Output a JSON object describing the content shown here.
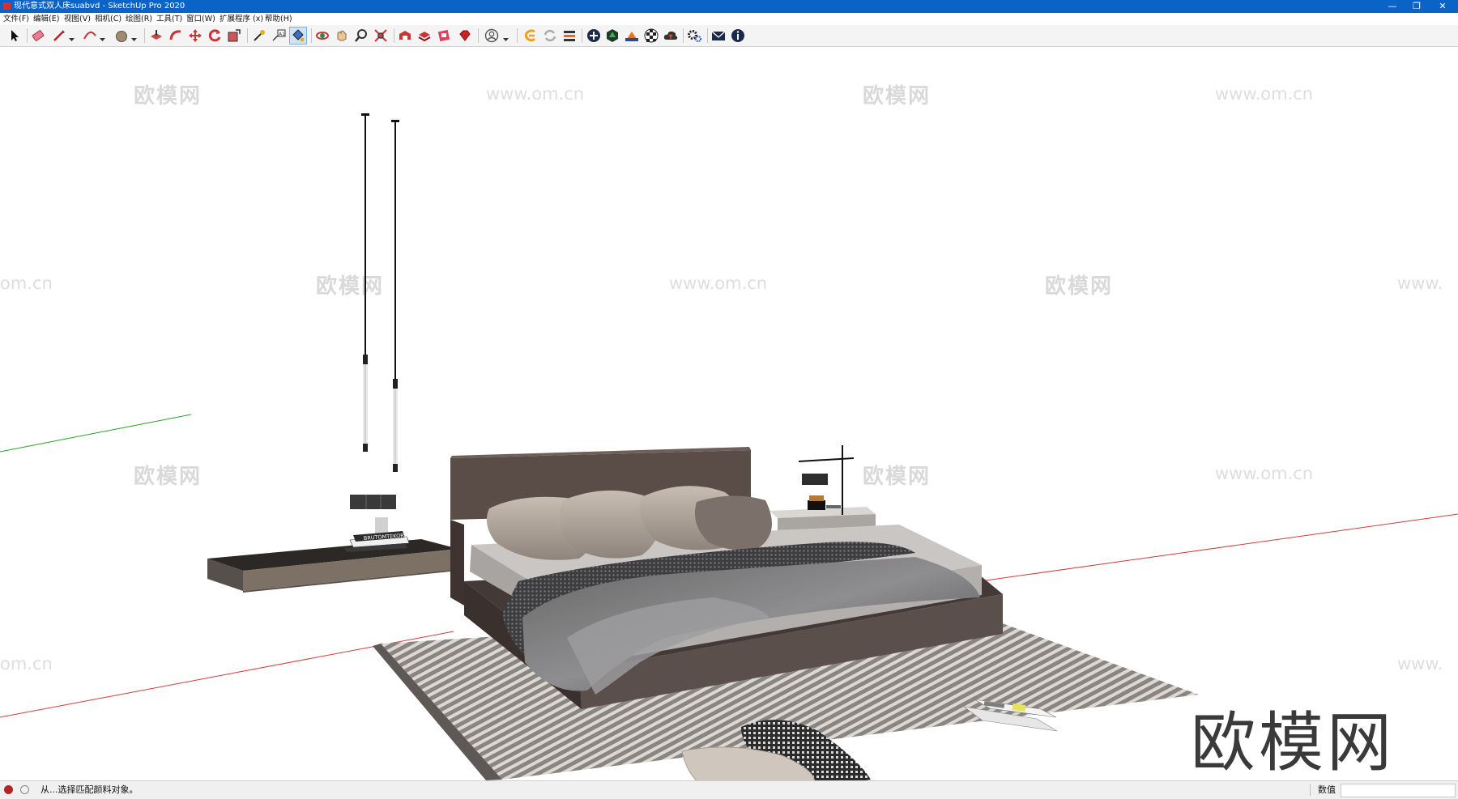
{
  "window": {
    "title": "现代意式双人床suabvd - SketchUp Pro 2020",
    "minimize_glyph": "—",
    "restore_glyph": "❐",
    "close_glyph": "✕"
  },
  "menu": {
    "items": [
      {
        "label": "文件(F)"
      },
      {
        "label": "编辑(E)"
      },
      {
        "label": "视图(V)"
      },
      {
        "label": "相机(C)"
      },
      {
        "label": "绘图(R)"
      },
      {
        "label": "工具(T)"
      },
      {
        "label": "窗口(W)"
      },
      {
        "label": "扩展程序 (x)"
      },
      {
        "label": "帮助(H)"
      }
    ]
  },
  "toolbar": {
    "tools": [
      {
        "name": "select-icon"
      },
      {
        "name": "eraser-icon"
      },
      {
        "name": "line-icon"
      },
      {
        "name": "arc-icon"
      },
      {
        "name": "circle-icon"
      },
      {
        "name": "push-pull-icon"
      },
      {
        "name": "follow-me-icon"
      },
      {
        "name": "move-icon"
      },
      {
        "name": "rotate-icon"
      },
      {
        "name": "scale-icon"
      },
      {
        "name": "tape-measure-icon"
      },
      {
        "name": "text-icon"
      },
      {
        "name": "paint-bucket-icon"
      },
      {
        "name": "orbit-icon"
      },
      {
        "name": "pan-icon"
      },
      {
        "name": "zoom-icon"
      },
      {
        "name": "zoom-extents-icon"
      },
      {
        "name": "warehouse-icon"
      },
      {
        "name": "extension-warehouse-icon"
      },
      {
        "name": "layout-icon"
      },
      {
        "name": "ruby-icon"
      },
      {
        "name": "account-icon"
      },
      {
        "name": "plugin-logo-icon"
      },
      {
        "name": "sync-icon"
      },
      {
        "name": "stack-icon"
      },
      {
        "name": "add-icon"
      },
      {
        "name": "cube-icon"
      },
      {
        "name": "gradient-icon"
      },
      {
        "name": "checker-icon"
      },
      {
        "name": "cloud-icon"
      },
      {
        "name": "settings-icon"
      },
      {
        "name": "mail-icon"
      },
      {
        "name": "info-icon"
      }
    ],
    "active_tool": "paint-bucket-icon"
  },
  "watermarks": {
    "brand": "欧模网",
    "url": "www.om.cn",
    "url_fragment_left": "om.cn",
    "url_fragment_right": "www."
  },
  "brand_logo": "欧模网",
  "book_spine": "BRUTOMTEKORA",
  "status": {
    "message": "从...选择匹配颜料对象。",
    "measurements_label": "数值",
    "measurements_value": ""
  },
  "colors": {
    "titlebar": "#0a64c8",
    "axis_red": "#d23c3c",
    "axis_green": "#2aa02a",
    "bed_frame": "#5a4c47",
    "rug": "#7d7773",
    "linen": "#c9c6c4"
  }
}
